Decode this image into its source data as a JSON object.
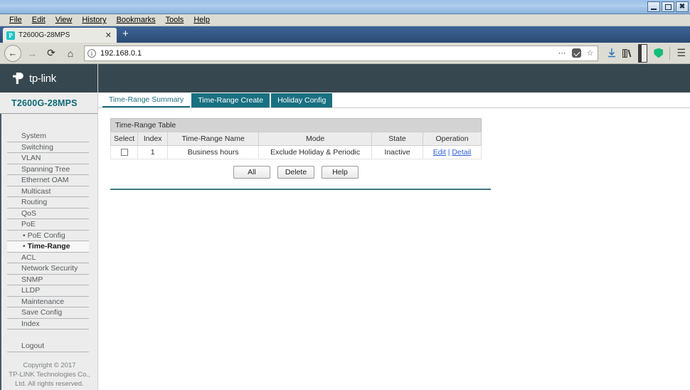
{
  "window": {
    "minimize_label": "minimize",
    "maximize_label": "maximize",
    "close_label": "✖"
  },
  "menubar": {
    "items": [
      "File",
      "Edit",
      "View",
      "History",
      "Bookmarks",
      "Tools",
      "Help"
    ]
  },
  "browser": {
    "tab_title": "T2600G-28MPS",
    "favicon_letter": "P",
    "tab_close": "✕",
    "new_tab": "+",
    "back": "←",
    "forward": "→",
    "reload": "⟳",
    "home": "⌂",
    "url": "192.168.0.1",
    "info_icon": "i",
    "page_actions": "⋯",
    "bookmark_star": "☆",
    "download_icon": "↓",
    "library_icon": "Ⅱ\\",
    "menu_icon": "☰"
  },
  "brand": {
    "word": "tp-link",
    "model": "T2600G-28MPS"
  },
  "sidebar": {
    "items": [
      {
        "label": "System",
        "type": "top",
        "active": false
      },
      {
        "label": "Switching",
        "type": "top",
        "active": false
      },
      {
        "label": "VLAN",
        "type": "top",
        "active": false
      },
      {
        "label": "Spanning Tree",
        "type": "top",
        "active": false
      },
      {
        "label": "Ethernet OAM",
        "type": "top",
        "active": false
      },
      {
        "label": "Multicast",
        "type": "top",
        "active": false
      },
      {
        "label": "Routing",
        "type": "top",
        "active": false
      },
      {
        "label": "QoS",
        "type": "top",
        "active": false
      },
      {
        "label": "PoE",
        "type": "top",
        "active": false
      },
      {
        "label": "PoE Config",
        "type": "sub",
        "active": false
      },
      {
        "label": "Time-Range",
        "type": "sub",
        "active": true
      },
      {
        "label": "ACL",
        "type": "top",
        "active": false
      },
      {
        "label": "Network Security",
        "type": "top",
        "active": false
      },
      {
        "label": "SNMP",
        "type": "top",
        "active": false
      },
      {
        "label": "LLDP",
        "type": "top",
        "active": false
      },
      {
        "label": "Maintenance",
        "type": "top",
        "active": false
      },
      {
        "label": "Save Config",
        "type": "top",
        "active": false
      },
      {
        "label": "Index",
        "type": "top",
        "active": false
      }
    ],
    "logout": "Logout",
    "copyright_line1": "Copyright © 2017",
    "copyright_line2": "TP-LINK Technologies Co.,",
    "copyright_line3": "Ltd. All rights reserved."
  },
  "tabs": [
    {
      "label": "Time-Range Summary",
      "active": true
    },
    {
      "label": "Time-Range Create",
      "active": false
    },
    {
      "label": "Holiday Config",
      "active": false
    }
  ],
  "table": {
    "caption": "Time-Range Table",
    "columns": [
      "Select",
      "Index",
      "Time-Range Name",
      "Mode",
      "State",
      "Operation"
    ],
    "rows": [
      {
        "select": "",
        "index": "1",
        "name": "Business hours",
        "mode": "Exclude Holiday & Periodic",
        "state": "Inactive",
        "operation_edit": "Edit",
        "operation_sep": " | ",
        "operation_detail": "Detail"
      }
    ]
  },
  "buttons": {
    "all": "All",
    "delete": "Delete",
    "help": "Help"
  },
  "colors": {
    "brand_dark": "#37474f",
    "brand_teal": "#197080",
    "accent_teal": "#1d6e7e",
    "link_blue": "#2b5fd9",
    "divider": "#3e7886"
  }
}
